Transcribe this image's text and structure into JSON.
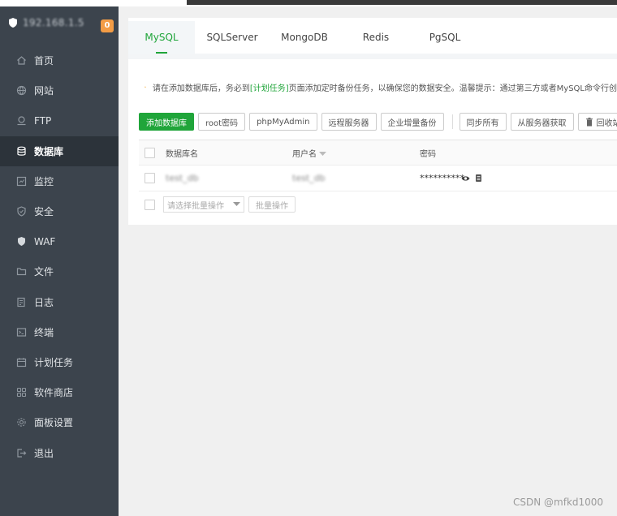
{
  "sidebar": {
    "server_name": "192.168.1.5",
    "badge": "0",
    "items": [
      {
        "label": "首页",
        "icon": "home-icon"
      },
      {
        "label": "网站",
        "icon": "globe-icon"
      },
      {
        "label": "FTP",
        "icon": "ftp-icon"
      },
      {
        "label": "数据库",
        "icon": "database-icon",
        "active": true
      },
      {
        "label": "监控",
        "icon": "monitor-icon"
      },
      {
        "label": "安全",
        "icon": "shield-icon"
      },
      {
        "label": "WAF",
        "icon": "waf-shield-icon"
      },
      {
        "label": "文件",
        "icon": "folder-icon"
      },
      {
        "label": "日志",
        "icon": "log-icon"
      },
      {
        "label": "终端",
        "icon": "terminal-icon"
      },
      {
        "label": "计划任务",
        "icon": "calendar-icon"
      },
      {
        "label": "软件商店",
        "icon": "grid-icon"
      },
      {
        "label": "面板设置",
        "icon": "gear-icon"
      },
      {
        "label": "退出",
        "icon": "logout-icon"
      }
    ]
  },
  "tabs": [
    {
      "label": "MySQL",
      "active": true
    },
    {
      "label": "SQLServer"
    },
    {
      "label": "MongoDB"
    },
    {
      "label": "Redis"
    },
    {
      "label": "PgSQL"
    }
  ],
  "notice": {
    "text_before": "请在添加数据库后，务必到",
    "link": "[计划任务]",
    "text_after": "页面添加定时备份任务，以确保您的数据安全。温馨提示：通过第三方或者MySQL命令行创"
  },
  "toolbar": {
    "add_db": "添加数据库",
    "root_pwd": "root密码",
    "phpmyadmin": "phpMyAdmin",
    "remote_server": "远程服务器",
    "enterprise_backup": "企业增量备份",
    "sync_all": "同步所有",
    "fetch_from_server": "从服务器获取",
    "recycle_bin": "回收站"
  },
  "table": {
    "headers": {
      "name": "数据库名",
      "user": "用户名",
      "password": "密码"
    },
    "rows": [
      {
        "name": "test_db",
        "user": "test_db",
        "password": "**********"
      }
    ]
  },
  "batch": {
    "select_placeholder": "请选择批量操作",
    "button": "批量操作"
  },
  "watermark": "CSDN @mfkd1000",
  "colors": {
    "accent": "#20a53a",
    "sidebar": "#3c444d",
    "badge": "#f39c45",
    "warning": "#f0a020"
  }
}
